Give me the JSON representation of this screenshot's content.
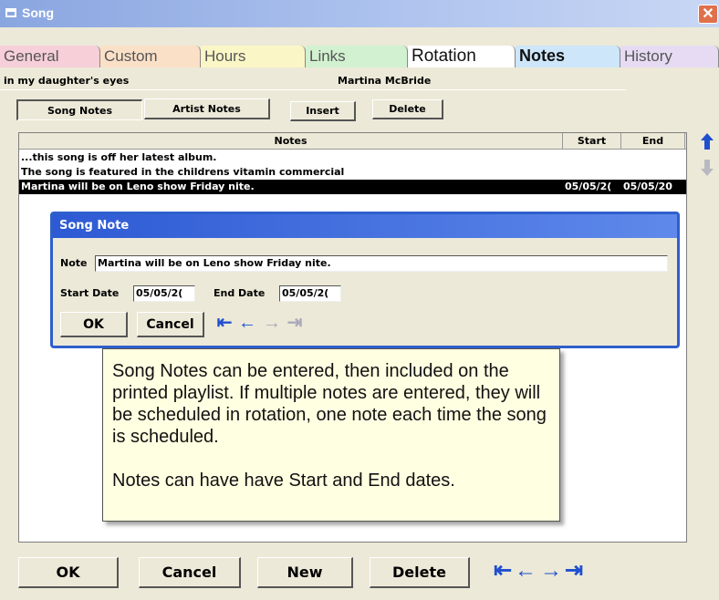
{
  "window": {
    "title": "Song",
    "close_glyph": "✕"
  },
  "tabs": [
    {
      "label": "General",
      "color": "#f6cfd8",
      "selected": false
    },
    {
      "label": "Custom",
      "color": "#fbe0c8",
      "selected": false
    },
    {
      "label": "Hours",
      "color": "#fbf6c6",
      "selected": false
    },
    {
      "label": "Links",
      "color": "#d2f1d0",
      "selected": false
    },
    {
      "label": "Rotation",
      "color": "#ffffff",
      "selected": false
    },
    {
      "label": "Notes",
      "color": "#cde6fa",
      "selected": true
    },
    {
      "label": "History",
      "color": "#e6dbf3",
      "selected": false
    }
  ],
  "song": {
    "title": "in my daughter's eyes",
    "artist": "Martina McBride"
  },
  "toolbar": {
    "song_notes": "Song Notes",
    "artist_notes": "Artist Notes",
    "insert": "Insert",
    "delete": "Delete"
  },
  "grid": {
    "headers": [
      "Notes",
      "Start",
      "End"
    ],
    "rows": [
      {
        "note": "...this song is off her latest album.",
        "start": "",
        "end": "",
        "selected": false
      },
      {
        "note": "The song is featured in the childrens vitamin commercial",
        "start": "",
        "end": "",
        "selected": false
      },
      {
        "note": "Martina will be on Leno show Friday nite.",
        "start": "05/05/2(",
        "end": "05/05/20",
        "selected": true
      }
    ]
  },
  "scroll": {
    "up_icon": "arrow-up-icon",
    "down_icon": "arrow-down-icon"
  },
  "dialog": {
    "title": "Song Note",
    "note_label": "Note",
    "note_value": "Martina will be on Leno show Friday nite.",
    "start_label": "Start Date",
    "start_value": "05/05/2(",
    "end_label": "End Date",
    "end_value": "05/05/2(",
    "ok": "OK",
    "cancel": "Cancel"
  },
  "tooltip": {
    "paragraph1": "Song Notes can be entered, then included on the printed playlist. If multiple notes are entered, they will be scheduled in rotation, one note each time the song is scheduled.",
    "paragraph2": "Notes can have have Start and End dates."
  },
  "bottom": {
    "ok": "OK",
    "cancel": "Cancel",
    "new": "New",
    "delete": "Delete"
  },
  "nav_glyphs": {
    "first": "⇤",
    "prev": "←",
    "next": "→",
    "last": "⇥"
  },
  "colors": {
    "dialog_border": "#2f5fcc",
    "nav_arrow": "#2050d0",
    "tooltip_bg": "#ffffe1"
  }
}
